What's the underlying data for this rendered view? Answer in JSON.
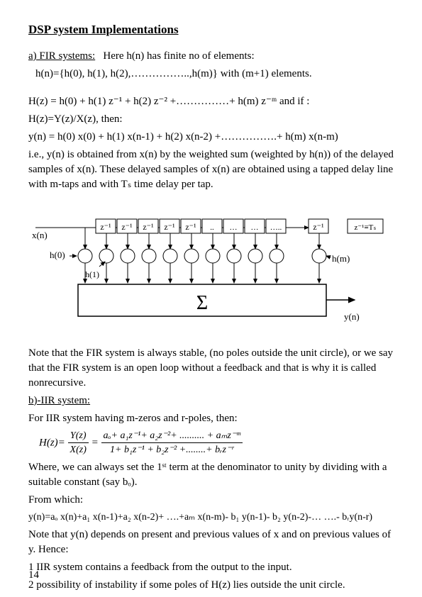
{
  "title": "DSP system Implementations",
  "fir": {
    "heading": "a) FIR systems:",
    "intro": "Here h(n) has finite no of elements:",
    "hn": "h(n)={h(0), h(1), h(2),……………..,h(m)} with (m+1) elements.",
    "hz1": "H(z) = h(0) + h(1) z⁻¹ + h(2) z⁻² +……………+ h(m) z⁻ᵐ and if :",
    "hz2": "H(z)=Y(z)/X(z), then:",
    "yn": "y(n) = h(0) x(0) + h(1) x(n-1) + h(2) x(n-2) +…………….+ h(m) x(n-m)",
    "explain": "i.e., y(n) is obtained from x(n) by the weighted sum (weighted by h(n)) of the delayed samples of x(n). These delayed samples of x(n) are obtained using a tapped delay line with m-taps and with Tₛ time delay per tap."
  },
  "diagram": {
    "xn": "x(n)",
    "h0": "h(0)",
    "h1": "h(1)",
    "hm": "h(m)",
    "yn": "y(n)",
    "z1": "z⁻¹",
    "sigma": "Σ",
    "zlabel": "z⁻¹≡Tₛ"
  },
  "note1": "Note that the FIR system is always stable, (no poles outside the unit circle), or we say that the FIR system is an open loop without a feedback and that is why it is called nonrecursive.",
  "iir": {
    "heading": "b)-IIR system:",
    "intro": "For IIR system having m-zeros and r-poles, then:",
    "hzlabel": "H(z)=",
    "num1": "Y(z)",
    "den1": "X(z)",
    "num2": "aₒ+ a₁z⁻¹+ a₂z⁻²+ .......... + aₘz⁻ᵐ",
    "den2": "1+ b₁z⁻¹ + b₂z⁻² +........+ bᵣz⁻ʳ",
    "where": "Where, we can always set the 1ˢᵗ term at the denominator to unity by dividing with a suitable constant (say bₒ).",
    "from": "From which:",
    "yn": "y(n)=aₒ x(n)+a₁ x(n-1)+a₂ x(n-2)+ ….+aₘ x(n-m)- b₁ y(n-1)- b₂ y(n-2)-… ….- bᵣy(n-r)",
    "note": "Note that y(n) depends on present and previous values of x and on previous values of y. Hence:",
    "pt1": "1  IIR system contains a feedback from the output to the input.",
    "pt2": "2  possibility of instability if some poles of H(z) lies outside the unit circle."
  },
  "pageNum": "14"
}
